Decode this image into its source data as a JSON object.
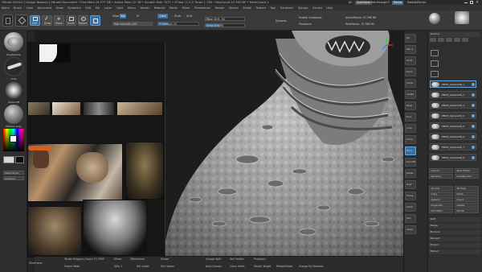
{
  "titlebar": {
    "text": "ZBrush 2024.0 [ Gregor Nowicki ]   ZBrush Document   • Free Mem 24.077 GB • Active Mem 12 GB • Scratch Disk 7472 • ZTime 11.5.2 Timer 1.738 • PolyCount 15.764 MP • MeshCount 1",
    "ac_label": "AC",
    "quicksave": "QuickSave",
    "seethrough": "See-through 0",
    "menus_label": "Menus",
    "default_script": "DefaultZScript"
  },
  "menubar": {
    "items": [
      "Alpha",
      "Brush",
      "Color",
      "Document",
      "Draw",
      "Dynamics",
      "Edit",
      "File",
      "Layer",
      "Light",
      "Macro",
      "Marker",
      "Material",
      "Movie",
      "Picker",
      "Preferences",
      "Render",
      "Stencil",
      "Stroke",
      "Texture",
      "Tool",
      "Transform",
      "Zplugin",
      "Zscript",
      "Help"
    ]
  },
  "toolshelf": {
    "edit": "Edit",
    "draw": "Draw",
    "move": "Move",
    "scale": "Scale",
    "rotate": "Rotate",
    "mrgb": "Mrgb",
    "rgb": "Rgb",
    "m": "M",
    "zadd": "Zadd",
    "zsub": "Zsub",
    "zcut": "Zcut",
    "rgb_intensity": "Rgb Intensity 100",
    "z_intensity": "Z Intensity 25",
    "focal_shift": "Focal Shift -94",
    "draw_size": "Draw Size 78",
    "dynamic": "Dynamic",
    "active_points": "ActivePoints: 15.766 Mil",
    "total_points": "TotalPoints: 15.766 Mil",
    "enable_customize": "Enable Customize",
    "transform_label": "Transform"
  },
  "leftpanel": {
    "clay_label": "ClayBuildup",
    "standard_label": "Standard",
    "stroke_label": "Dots",
    "alpha_label": "Alpha Off",
    "texture_label": "Texture Off",
    "material_label": "MatCap Gray",
    "switch_color": "SwitchColor",
    "gradient": "Gradient",
    "primary_color": "#d6d6d6",
    "secondary_color": "#101010"
  },
  "bottombar": {
    "target_polygons": "Target Polygons Count 15.7993",
    "mirror": "Mirror",
    "zremesher": "ZRemesher",
    "frame_mesh": "Frame Mesh",
    "topology": "Topology",
    "groups_split": "Groups Split",
    "del_hidden": "Del Hidden",
    "polypaint": "Polypaint",
    "close_holes": "Close Holes",
    "morph_target": "Morph Target",
    "merge_visible": "MergeVisible",
    "groups_by_normals": "Groups By Normals",
    "auto_groups": "Auto Groups",
    "del_lower": "Del Lower",
    "del_higher": "Del Higher",
    "divide": "Divide",
    "smt": "Smt",
    "resolution": "Resolution",
    "reconstruct": "Reconstruct Subdiv",
    "left_info": "Wireframe",
    "sdiv": "SDiv 1"
  },
  "rightpanel": {
    "header": "Subtool",
    "items": [
      {
        "label": "PM3D_Sphere3D_1"
      },
      {
        "label": "PM3D_Sphere3D_2"
      },
      {
        "label": "PM3D_Sphere3D_3"
      },
      {
        "label": "PM3D_Sphere3D_4"
      },
      {
        "label": "PM3D_Sphere3D_5"
      },
      {
        "label": "PM3D_Sphere3D_6"
      },
      {
        "label": "PM3D_Sphere3D_7"
      },
      {
        "label": "PM3D_Sphere3D_8"
      }
    ],
    "list_all": "List All",
    "new_folder": "New Folder",
    "rename": "Rename",
    "auto_reorder": "AutoReorder",
    "all_low": "All Low",
    "all_high": "All High",
    "copy": "Copy",
    "paste": "Paste",
    "append": "Append",
    "insert": "Insert",
    "duplicate": "Duplicate",
    "delete": "Delete",
    "del_other": "Del Other",
    "del_all": "Del All",
    "split": "Split",
    "merge": "Merge",
    "boolean": "Boolean",
    "remesh": "Remesh",
    "project": "Project",
    "extract": "Extract"
  },
  "rightstrip": {
    "buttons": [
      "Bpr",
      "SPix 3",
      "Scroll",
      "Zoom",
      "Actual",
      "AAHalf",
      "Persp",
      "Floor",
      "Local",
      "Frame",
      "Move",
      "Zoom3D",
      "Rotate",
      "PolyF",
      "Transp",
      "Ghost",
      "Solo",
      "Xpose"
    ]
  },
  "colors": {
    "accent_blue": "#3b6fa0",
    "panel_bg": "#2f2f2f",
    "canvas_bg": "#1d1d1d"
  }
}
